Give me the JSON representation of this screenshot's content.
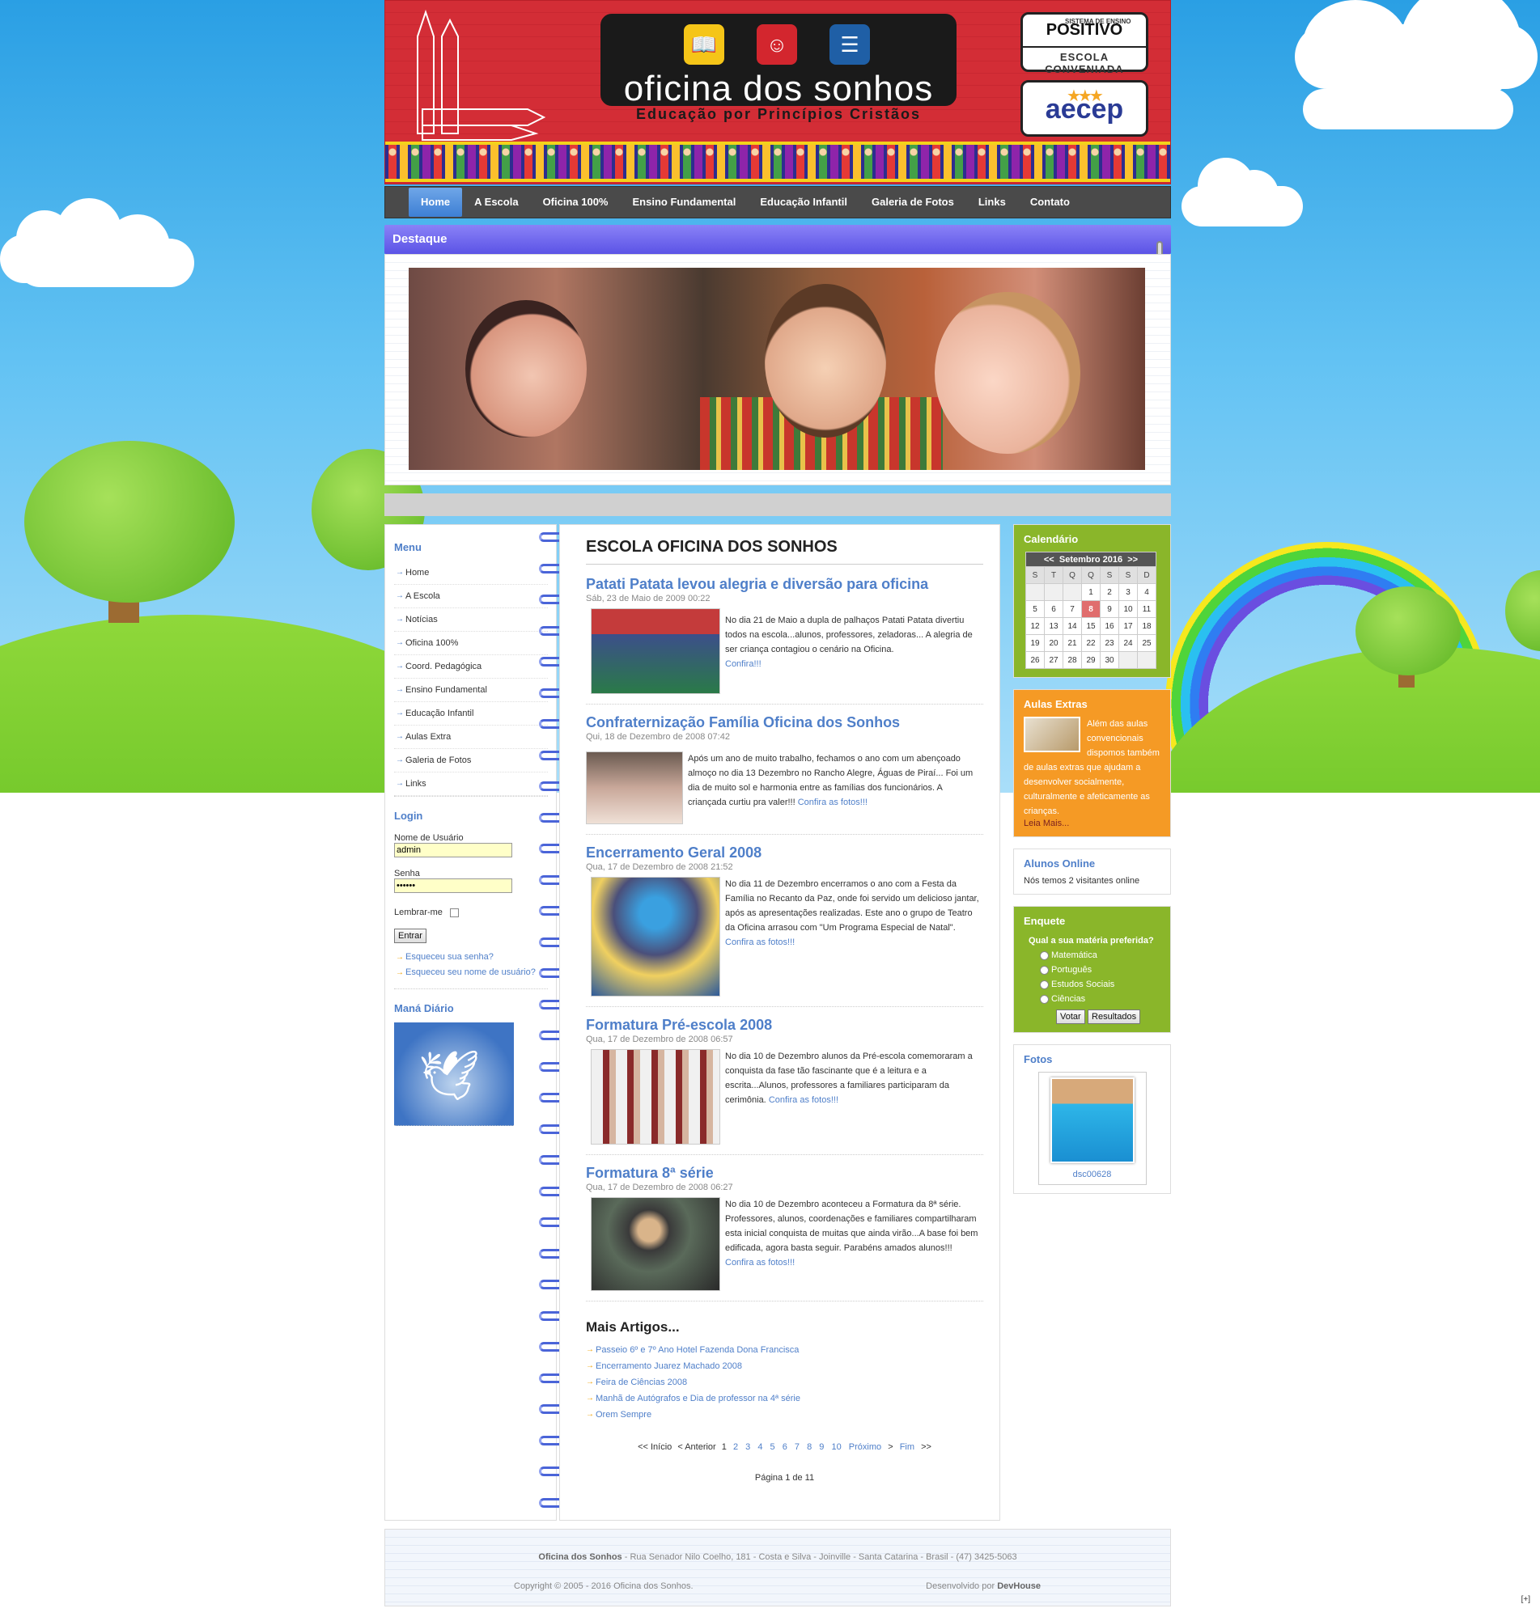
{
  "header": {
    "logo_title": "oficina dos sonhos",
    "logo_subtitle": "Educação por Princípios Cristãos",
    "badge1_small": "SISTEMA DE ENSINO",
    "badge1_title": "POSITIVO",
    "badge1_sub": "ESCOLA CONVENIADA",
    "badge2_title": "aecep"
  },
  "nav": {
    "items": [
      "Home",
      "A Escola",
      "Oficina 100%",
      "Ensino Fundamental",
      "Educação Infantil",
      "Galeria de Fotos",
      "Links",
      "Contato"
    ]
  },
  "destaque": {
    "title": "Destaque"
  },
  "left": {
    "menu_title": "Menu",
    "menu_items": [
      "Home",
      "A Escola",
      "Notícias",
      "Oficina 100%",
      "Coord. Pedagógica",
      "Ensino Fundamental",
      "Educação Infantil",
      "Aulas Extra",
      "Galeria de Fotos",
      "Links"
    ],
    "login_title": "Login",
    "username_label": "Nome de Usuário",
    "username_value": "admin",
    "password_label": "Senha",
    "password_value": "••••••",
    "remember_label": "Lembrar-me",
    "submit_label": "Entrar",
    "forgot_password": "Esqueceu sua senha?",
    "forgot_username": "Esqueceu seu nome de usuário?",
    "mana_title": "Maná Diário"
  },
  "main": {
    "title": "ESCOLA OFICINA DOS SONHOS",
    "articles": [
      {
        "title": "Patati Patata levou alegria e diversão para oficina",
        "date": "Sáb, 23 de Maio de 2009 00:22",
        "text": "No dia 21 de Maio a dupla de palhaços Patati Patata divertiu todos na escola...alunos, professores, zeladoras... A alegria de ser criança contagiou o cenário na Oficina.",
        "more": "Confira!!!"
      },
      {
        "title": "Confraternização Família Oficina dos Sonhos",
        "date": "Qui, 18 de Dezembro de 2008 07:42",
        "text": "Após um  ano de muito trabalho, fechamos o ano com um abençoado almoço no dia 13 Dezembro no Rancho Alegre, Águas de Piraí... Foi um dia de muito sol e harmonia entre as famílias dos funcionários. A criançada curtiu pra valer!!!",
        "more": "Confira as fotos!!!"
      },
      {
        "title": "Encerramento Geral 2008",
        "date": "Qua, 17 de Dezembro de 2008 21:52",
        "text": "No dia 11 de Dezembro encerramos o ano com  a Festa  da Família no Recanto da Paz, onde foi servido um delicioso jantar, após as apresentações realizadas. Este  ano o grupo de Teatro da Oficina  arrasou com \"Um Programa Especial de Natal\".",
        "more": "Confira as fotos!!!"
      },
      {
        "title": "Formatura Pré-escola 2008",
        "date": "Qua, 17 de Dezembro de 2008 06:57",
        "text": "No dia 10 de Dezembro alunos da Pré-escola comemoraram a conquista da fase tão fascinante que é a leitura e a escrita...Alunos, professores a familiares participaram da cerimônia.",
        "more": "Confira as fotos!!!"
      },
      {
        "title": "Formatura 8ª série",
        "date": "Qua, 17 de Dezembro de 2008 06:27",
        "text": "No dia 10 de Dezembro aconteceu a Formatura da 8ª série. Professores, alunos, coordenações e familiares compartilharam esta inicial conquista de muitas que ainda virão...A base foi bem edificada, agora basta seguir. Parabéns amados alunos!!!",
        "more": "Confira as fotos!!!"
      }
    ],
    "more_title": "Mais Artigos...",
    "more_items": [
      "Passeio 6º e 7º Ano Hotel Fazenda Dona Francisca",
      "Encerramento Juarez Machado 2008",
      "Feira de Ciências 2008",
      "Manhã de Autógrafos e Dia de professor na 4ª série",
      "Orem Sempre"
    ],
    "pager": {
      "start": "<< Início",
      "prev": "< Anterior",
      "current": "1",
      "pages": [
        "2",
        "3",
        "4",
        "5",
        "6",
        "7",
        "8",
        "9",
        "10"
      ],
      "next": "Próximo",
      "next_arrow": ">",
      "end": "Fim",
      "end_arrow": ">>"
    },
    "page_info": "Página 1 de 11"
  },
  "right": {
    "calendar_title": "Calendário",
    "calendar_prev": "<<",
    "calendar_month": "Setembro 2016",
    "calendar_next": ">>",
    "calendar_dow": [
      "S",
      "T",
      "Q",
      "Q",
      "S",
      "S",
      "D"
    ],
    "calendar_weeks": [
      [
        "",
        "",
        "",
        "1",
        "2",
        "3",
        "4"
      ],
      [
        "5",
        "6",
        "7",
        "8",
        "9",
        "10",
        "11"
      ],
      [
        "12",
        "13",
        "14",
        "15",
        "16",
        "17",
        "18"
      ],
      [
        "19",
        "20",
        "21",
        "22",
        "23",
        "24",
        "25"
      ],
      [
        "26",
        "27",
        "28",
        "29",
        "30",
        "",
        ""
      ]
    ],
    "calendar_today": "8",
    "aulas_title": "Aulas Extras",
    "aulas_text": "Além das aulas convencionais dispomos também de aulas extras que ajudam a desenvolver socialmente, culturalmente e afeticamente as crianças.",
    "aulas_more": "Leia Mais...",
    "online_title": "Alunos Online",
    "online_text": "Nós temos 2 visitantes online",
    "poll_title": "Enquete",
    "poll_question": "Qual a sua matéria preferida?",
    "poll_options": [
      "Matemática",
      "Português",
      "Estudos Sociais",
      "Ciências"
    ],
    "poll_vote": "Votar",
    "poll_results": "Resultados",
    "photos_title": "Fotos",
    "photo_caption": "dsc00628"
  },
  "footer": {
    "name": "Oficina dos Sonhos",
    "address": " - Rua Senador Nilo Coelho, 181 - Costa e Silva - Joinville - Santa Catarina - Brasil - (47) 3425-5063",
    "copyright": "Copyright © 2005 - 2016 Oficina dos Sonhos.",
    "dev_prefix": "Desenvolvido por ",
    "dev_name": "DevHouse"
  },
  "corner": "[+]",
  "colors": {
    "header_red": "#d32d36",
    "nav_gray": "#4a4a4a",
    "link_blue": "#4f7fc9",
    "green_box": "#8ab62a",
    "orange_box": "#f59a25",
    "destaque_purple": "#6b63ee"
  }
}
